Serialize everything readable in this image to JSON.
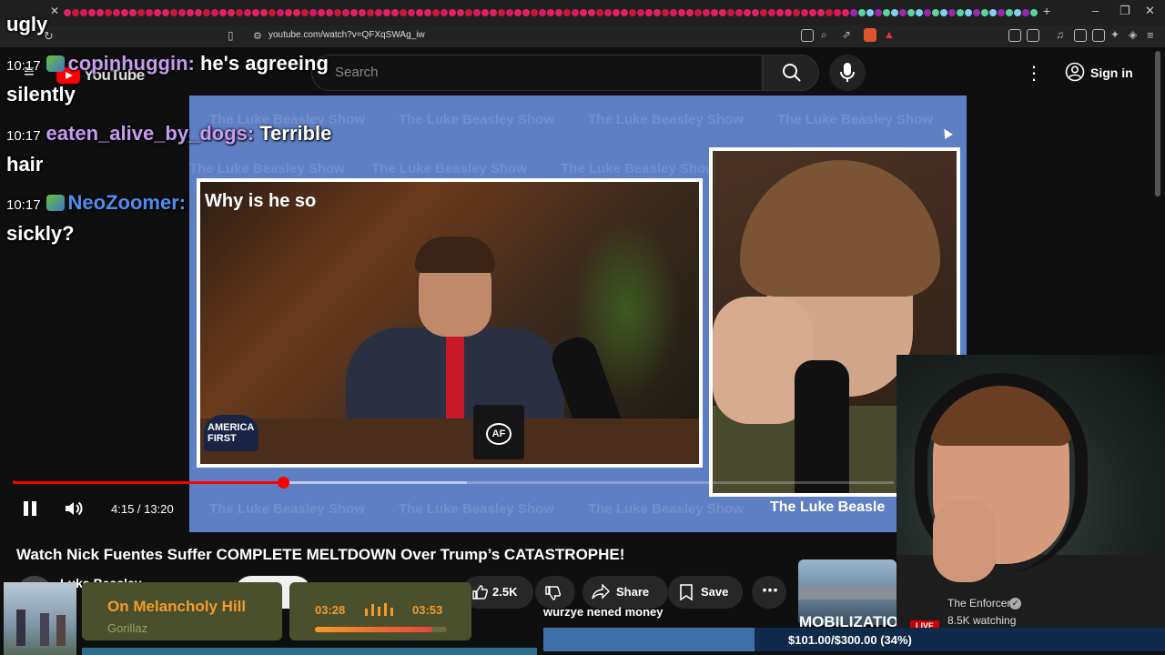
{
  "browser": {
    "url": "youtube.com/watch?v=QFXqSWAg_iw"
  },
  "youtube": {
    "logo_text": "YouTube",
    "search_placeholder": "Search",
    "sign_in": "Sign in"
  },
  "video": {
    "clip_caption": "Why is he so",
    "clip_cap_text": "AMERICA FIRST",
    "mug_text": "AF",
    "watermark": "The Luke Beasley Show",
    "host_name_plate": "The Luke Beasle",
    "time_display": "4:15 / 13:20",
    "progress_played": 0.307,
    "progress_buffered": 0.515,
    "title": "Watch Nick Fuentes Suffer COMPLETE MELTDOWN Over Trump’s CATASTROPHE!",
    "channel_name": "Luke Beasley",
    "likes": "2.5K",
    "share_label": "Share",
    "save_label": "Save"
  },
  "chat": [
    {
      "time": "",
      "user": "",
      "message": "ugly",
      "top": true
    },
    {
      "time": "10:17",
      "user": "copinhuggin:",
      "message": "he's agreeing",
      "cont": "silently",
      "badge": true
    },
    {
      "time": "10:17",
      "user": "eaten_alive_by_dogs:",
      "message": "Terrible",
      "cont": "hair",
      "badge": false
    },
    {
      "time": "10:17",
      "user": "NeoZoomer:",
      "message": "Why is he so",
      "cont": "sickly?",
      "badge": true
    }
  ],
  "suggested": {
    "thumb_text": "MOBILIZATION",
    "live": "LIVE",
    "channel": "The Enforcer",
    "watching": "8.5K watching"
  },
  "now_playing": {
    "title": "On Melancholy Hill",
    "artist": "Gorillaz",
    "current": "03:28",
    "total": "03:53",
    "progress": 0.89
  },
  "donation": {
    "message": "wurzye nened money",
    "goal_text": "$101.00/$300.00 (34%)",
    "progress": 0.34
  },
  "colors": {
    "accent_red": "#ff0000",
    "video_bg": "#5e7fc4",
    "np_orange": "#f39b2b"
  }
}
